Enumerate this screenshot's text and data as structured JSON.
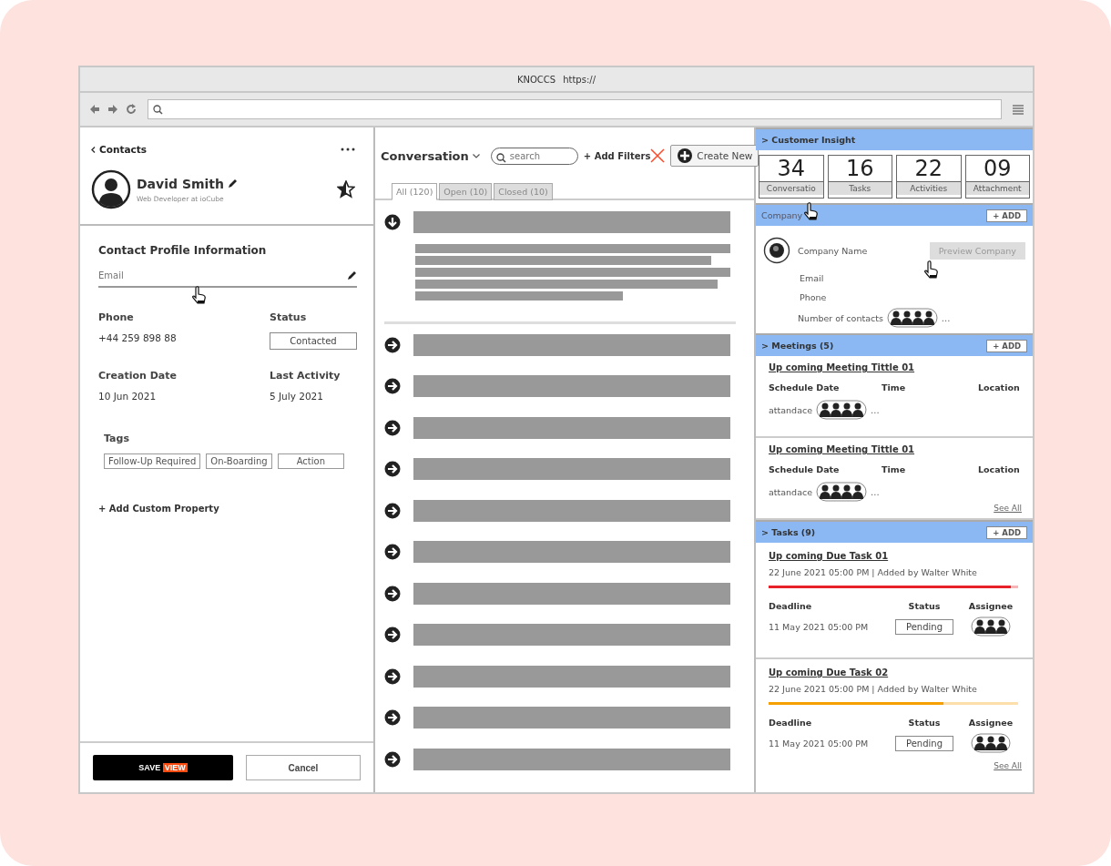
{
  "browser": {
    "title": "KNOCCS",
    "url_label": "https://"
  },
  "contact_panel": {
    "back_link": "Contacts",
    "name": "David Smith",
    "subtitle": "Web Developer at ioCube",
    "section_title": "Contact Profile Information",
    "email": {
      "placeholder": "Email"
    },
    "fields": [
      {
        "label": "Phone",
        "value": "+44 259 898 88",
        "kind": "text"
      },
      {
        "label": "Status",
        "value": "Contacted",
        "kind": "badge"
      },
      {
        "label": "Creation Date",
        "value": "10 Jun 2021",
        "kind": "text"
      },
      {
        "label": "Last Activity",
        "value": "5 July 2021",
        "kind": "text"
      }
    ],
    "tags_label": "Tags",
    "tags": [
      "Follow-Up Required",
      "On-Boarding",
      "Action"
    ],
    "add_property": "+ Add Custom Property",
    "save_button": {
      "label": "SAVE",
      "highlight": "VIEW"
    },
    "cancel_button": "Cancel"
  },
  "conversation": {
    "title": "Conversation",
    "search_placeholder": "search",
    "add_filters": {
      "label": "+ Add Filters",
      "crossed_out": true
    },
    "create_button": "Create New",
    "tabs": [
      {
        "label": "All (120)",
        "selected": true
      },
      {
        "label": "Open (10)",
        "selected": false
      },
      {
        "label": "Closed (10)",
        "selected": false
      }
    ],
    "items": [
      {
        "expanded": true
      },
      {
        "expanded": false
      },
      {
        "expanded": false
      },
      {
        "expanded": false
      },
      {
        "expanded": false
      },
      {
        "expanded": false
      },
      {
        "expanded": false
      },
      {
        "expanded": false
      },
      {
        "expanded": false
      },
      {
        "expanded": false
      },
      {
        "expanded": false
      },
      {
        "expanded": false
      }
    ]
  },
  "insight": {
    "title": "> Customer Insight",
    "stats": [
      {
        "value": "34",
        "label": "Conversatio"
      },
      {
        "value": "16",
        "label": "Tasks"
      },
      {
        "value": "22",
        "label": "Activities"
      },
      {
        "value": "09",
        "label": "Attachment"
      }
    ]
  },
  "company": {
    "title": "Company",
    "add": "+ ADD",
    "name_label": "Company Name",
    "preview_button": "Preview Company",
    "rows": [
      "Email",
      "Phone"
    ],
    "contacts_label": "Number of contacts",
    "more": "..."
  },
  "meetings": {
    "title": "> Meetings (5)",
    "add": "+ ADD",
    "items": [
      {
        "title": "Up coming Meeting Tittle 01",
        "columns": [
          "Schedule Date",
          "Time",
          "Location"
        ],
        "attendance_label": "attandace",
        "more": "..."
      },
      {
        "title": "Up coming Meeting Tittle 01",
        "columns": [
          "Schedule Date",
          "Time",
          "Location"
        ],
        "attendance_label": "attandace",
        "more": "..."
      }
    ],
    "see_all": "See All"
  },
  "tasks": {
    "title": "> Tasks (9)",
    "add": "+ ADD",
    "items": [
      {
        "title": "Up coming Due Task 01",
        "meta": "22 June 2021 05:00 PM | Added by Walter White",
        "color": "#e8202a",
        "level": 0.97,
        "deadline_label": "Deadline",
        "deadline": "11 May 2021 05:00 PM",
        "status_label": "Status",
        "status": "Pending",
        "assignee_label": "Assignee"
      },
      {
        "title": "Up coming Due Task 02",
        "meta": "22 June 2021 05:00 PM | Added by Walter White",
        "color": "#f5a000",
        "level": 0.7,
        "deadline_label": "Deadline",
        "deadline": "11 May 2021 05:00 PM",
        "status_label": "Status",
        "status": "Pending",
        "assignee_label": "Assignee"
      }
    ],
    "see_all": "See All"
  }
}
